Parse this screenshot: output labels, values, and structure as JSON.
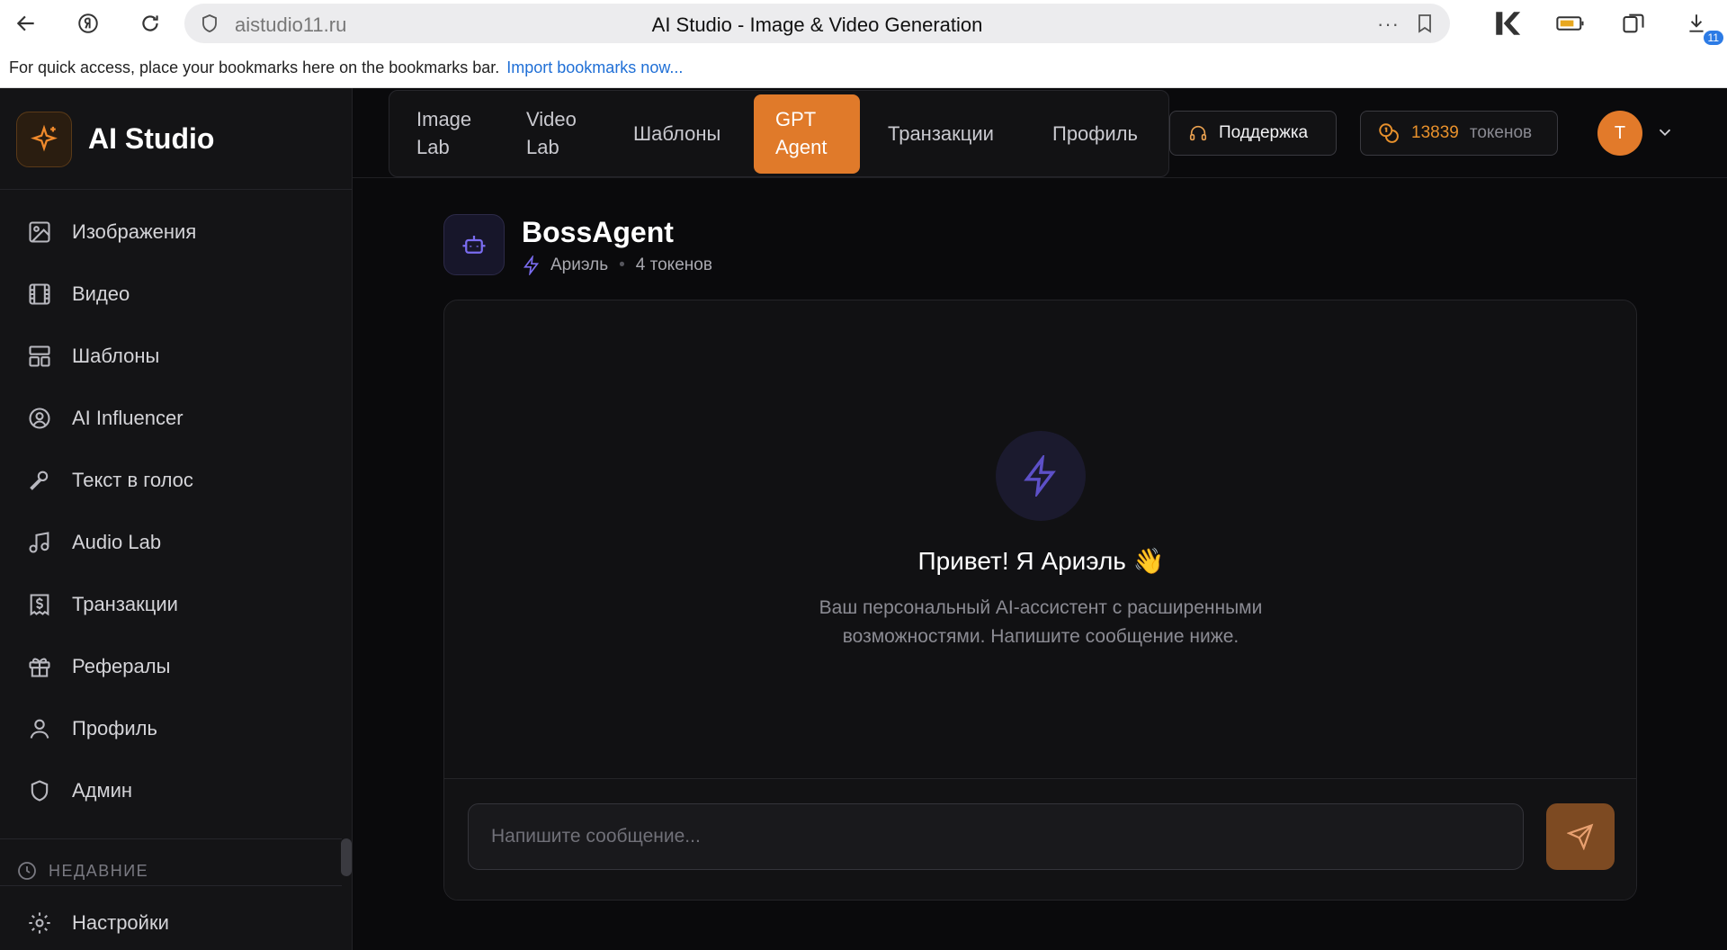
{
  "browser": {
    "url": "aistudio11.ru",
    "page_title": "AI Studio - Image & Video Generation",
    "more_dots": "···",
    "downloads_badge": "11",
    "bookmarks_prompt": "For quick access, place your bookmarks here on the bookmarks bar.",
    "import_link": "Import bookmarks now..."
  },
  "app": {
    "name": "AI Studio",
    "accent": "#e07a2a"
  },
  "sidebar": {
    "items": [
      {
        "label": "Изображения"
      },
      {
        "label": "Видео"
      },
      {
        "label": "Шаблоны"
      },
      {
        "label": "AI Influencer"
      },
      {
        "label": "Текст в голос"
      },
      {
        "label": "Audio Lab"
      },
      {
        "label": "Транзакции"
      },
      {
        "label": "Рефералы"
      },
      {
        "label": "Профиль"
      },
      {
        "label": "Админ"
      }
    ],
    "recent_label": "НЕДАВНИЕ",
    "settings_label": "Настройки"
  },
  "topnav": {
    "tabs": [
      {
        "line1": "Image",
        "line2": "Lab"
      },
      {
        "line1": "Video",
        "line2": "Lab"
      },
      {
        "label": "Шаблоны"
      },
      {
        "line1": "GPT",
        "line2": "Agent",
        "active": true
      },
      {
        "label": "Транзакции"
      },
      {
        "label": "Профиль"
      }
    ],
    "support_label": "Поддержка",
    "tokens_count": "13839",
    "tokens_label": "токенов",
    "avatar_initial": "T"
  },
  "agent": {
    "name": "BossAgent",
    "persona": "Ариэль",
    "separator": "•",
    "cost": "4 токенов"
  },
  "chat": {
    "greeting": "Привет! Я Ариэль 👋",
    "description": "Ваш персональный AI-ассистент с расширенными возможностями. Напишите сообщение ниже.",
    "input_placeholder": "Напишите сообщение...",
    "input_value": ""
  }
}
